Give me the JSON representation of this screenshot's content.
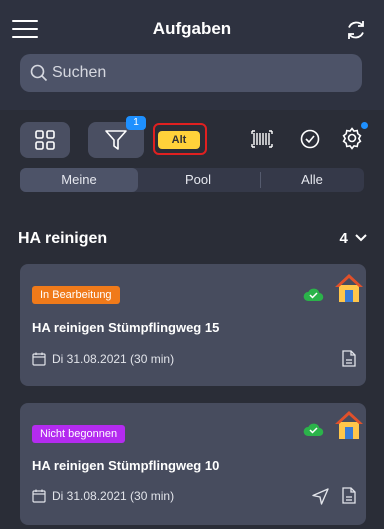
{
  "header": {
    "title": "Aufgaben"
  },
  "search": {
    "placeholder": "Suchen"
  },
  "toolbar": {
    "filter_badge": "1",
    "alt_label": "Alt"
  },
  "segments": [
    {
      "label": "Meine",
      "active": true
    },
    {
      "label": "Pool",
      "active": false
    },
    {
      "label": "Alle",
      "active": false
    }
  ],
  "section": {
    "title": "HA reinigen",
    "count": "4"
  },
  "cards": [
    {
      "status": "In Bearbeitung",
      "status_color": "#f07a1a",
      "title": "HA reinigen Stümpflingweg 15",
      "date": "Di 31.08.2021 (30 min)"
    },
    {
      "status": "Nicht begonnen",
      "status_color": "#b42bf0",
      "title": "HA reinigen Stümpflingweg 10",
      "date": "Di 31.08.2021 (30 min)"
    }
  ],
  "colors": {
    "cloud_ok": "#2bb34a",
    "house_roof": "#e0502a",
    "house_wall": "#ffc64a"
  }
}
